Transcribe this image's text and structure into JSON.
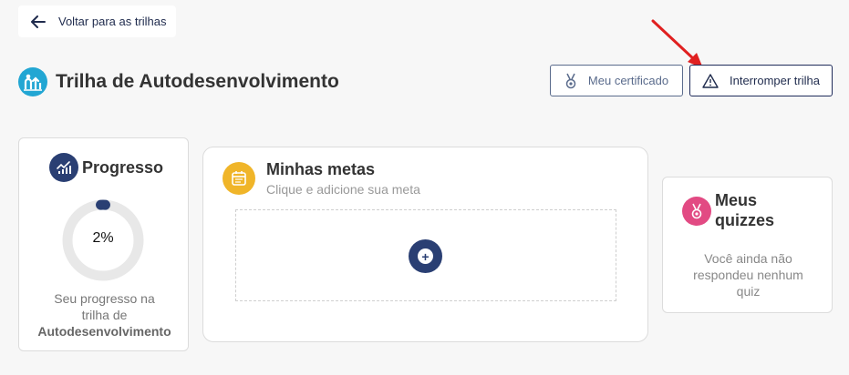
{
  "header": {
    "back_label": "Voltar para as trilhas",
    "title": "Trilha de Autodesenvolvimento",
    "certificate_label": "Meu certificado",
    "stop_label": "Interromper trilha"
  },
  "progress": {
    "title": "Progresso",
    "percent_value": 2,
    "percent_label": "2%",
    "text_line1": "Seu progresso na",
    "text_line2": "trilha de",
    "text_bold": "Autodesenvolvimento"
  },
  "goals": {
    "title": "Minhas metas",
    "subtitle": "Clique e adicione sua meta",
    "add_symbol": "+"
  },
  "quizzes": {
    "title_line1": "Meus",
    "title_line2": "quizzes",
    "text_line1": "Você ainda não",
    "text_line2": "respondeu nenhum",
    "text_line3": "quiz"
  },
  "colors": {
    "trail_icon": "#22a6d3",
    "progress_icon": "#2a3f73",
    "goals_icon": "#f0b529",
    "quiz_icon": "#e24a83",
    "annotation_arrow": "#e02020"
  },
  "icons": {
    "back": "arrow-left-icon",
    "trail": "trail-people-icon",
    "certificate": "medal-icon",
    "stop": "warning-triangle-icon",
    "progress": "progress-chart-icon",
    "goals": "calendar-icon",
    "add": "plus-icon",
    "quiz": "medal-icon"
  }
}
